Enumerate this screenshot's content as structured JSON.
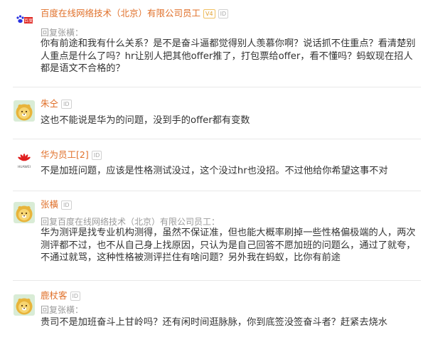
{
  "comments": [
    {
      "name": "百度在线网络技术（北京）有限公司员工",
      "badges": [
        "V4",
        "ID"
      ],
      "reply_to": "回复张橫：",
      "body": "你有前途和我有什么关系？是不是奋斗逼都觉得别人羡慕你啊？说话抓不住重点？看清楚别人重点是什么了吗？hr让别人把其他offer推了，打包票给offer，看不懂吗？蚂蚁现在招人都是语文不合格的？",
      "avatar_icon": "baidu-logo-icon"
    },
    {
      "name": "朱仝",
      "badges": [
        "ID"
      ],
      "body": "这也不能说是华为的问题，没到手的offer都有变数",
      "avatar_icon": "lion-avatar-icon"
    },
    {
      "name": "华为员工[2]",
      "badges": [
        "ID"
      ],
      "body": "不是加班问题，应该是性格测试没过，这个没过hr也没招。不过他给你希望这事不对",
      "avatar_icon": "huawei-logo-icon"
    },
    {
      "name": "张橫",
      "badges": [
        "ID"
      ],
      "reply_to": "回复百度在线网络技术（北京）有限公司员工：",
      "body": "华为测评是找专业机构测得，虽然不保证准，但也能大概率刷掉一些性格偏极端的人，两次测评都不过，也不从自己身上找原因，只认为是自己回答不愿加班的问题么，通过了就夸，不通过就骂，这种性格被测评拦住有啥问题？另外我在蚂蚁，比你有前途",
      "avatar_icon": "lion-avatar-icon"
    },
    {
      "name": "鹿杖客",
      "badges": [
        "ID"
      ],
      "reply_to": "回复张橫：",
      "body": "贵司不是加班奋斗上甘岭吗？还有闲时间逛脉脉，你到底签没签奋斗者？赶紧去烧水",
      "avatar_icon": "lion-avatar-icon"
    }
  ],
  "colors": {
    "name": "#e0702a",
    "body": "#333333",
    "meta": "#9a9a9a",
    "divider": "#e9e9e9",
    "avatar_bg": "#d9ecd6",
    "avatar_face": "#f0c030",
    "huawei": "#e02020",
    "baidu_blue": "#2932e1",
    "baidu_red": "#e0231e"
  }
}
